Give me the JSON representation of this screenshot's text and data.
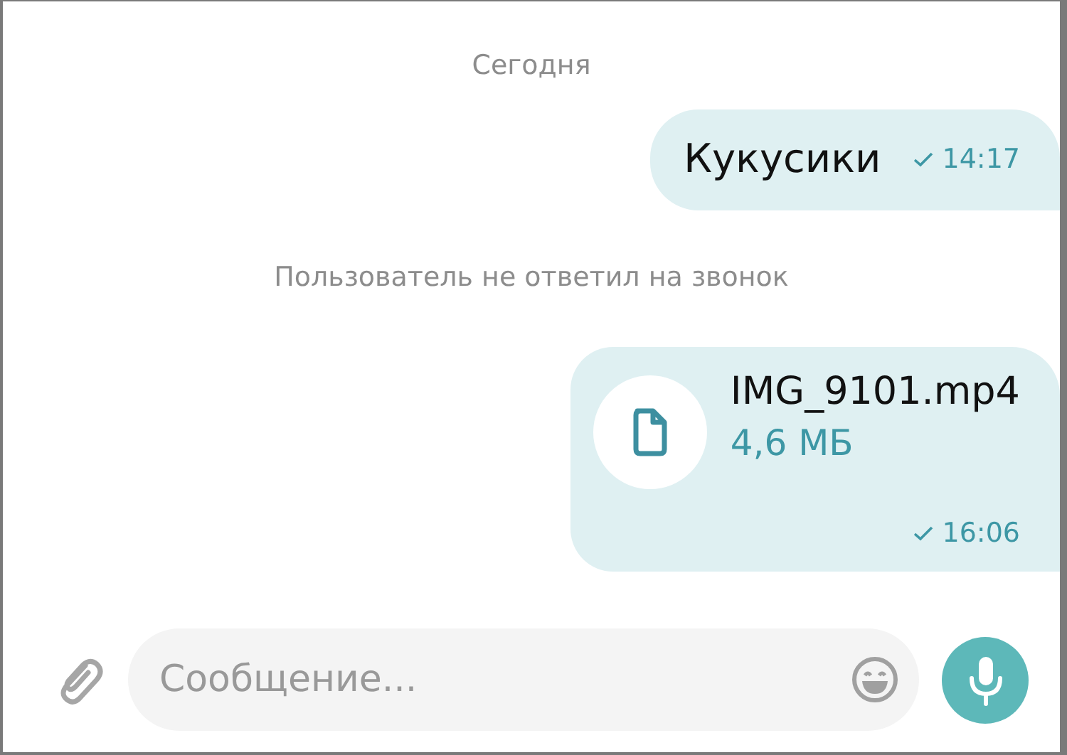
{
  "messages": [
    {
      "kind": "date",
      "text": "Сегодня"
    },
    {
      "kind": "text",
      "text": "Кукусики",
      "time": "14:17"
    },
    {
      "kind": "system",
      "text": "Пользователь не ответил на звонок"
    },
    {
      "kind": "file",
      "file_name": "IMG_9101.mp4",
      "size": "4,6 МБ",
      "time": "16:06"
    }
  ],
  "composer": {
    "placeholder": "Сообщение..."
  }
}
